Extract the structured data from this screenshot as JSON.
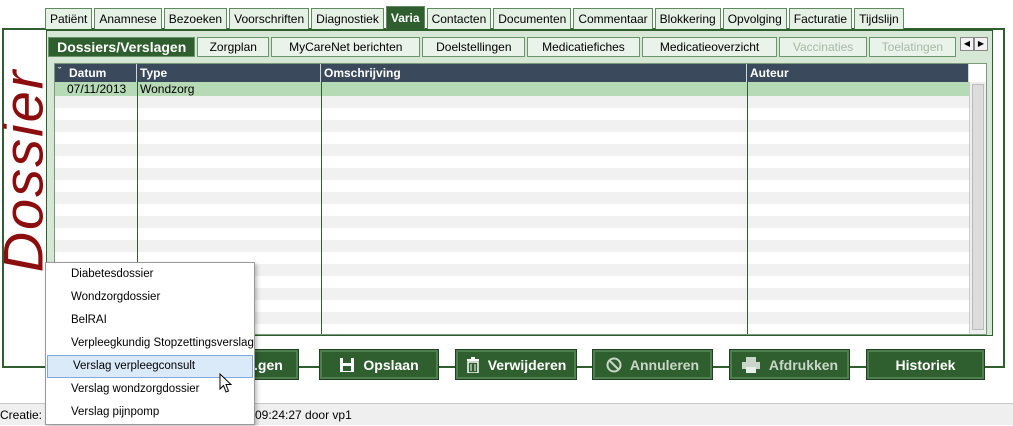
{
  "side_title": "Dossier",
  "main_tabs": [
    {
      "label": "Patiënt",
      "active": false
    },
    {
      "label": "Anamnese",
      "active": false
    },
    {
      "label": "Bezoeken",
      "active": false
    },
    {
      "label": "Voorschriften",
      "active": false
    },
    {
      "label": "Diagnostiek",
      "active": false
    },
    {
      "label": "Varia",
      "active": true
    },
    {
      "label": "Contacten",
      "active": false
    },
    {
      "label": "Documenten",
      "active": false
    },
    {
      "label": "Commentaar",
      "active": false
    },
    {
      "label": "Blokkering",
      "active": false
    },
    {
      "label": "Opvolging",
      "active": false
    },
    {
      "label": "Facturatie",
      "active": false
    },
    {
      "label": "Tijdslijn",
      "active": false
    }
  ],
  "sub_tabs": [
    {
      "label": "Dossiers/Verslagen",
      "state": "active"
    },
    {
      "label": "Zorgplan",
      "state": "normal"
    },
    {
      "label": "MyCareNet berichten",
      "state": "normal"
    },
    {
      "label": "Doelstellingen",
      "state": "normal"
    },
    {
      "label": "Medicatiefiches",
      "state": "normal"
    },
    {
      "label": "Medicatieoverzicht",
      "state": "normal"
    },
    {
      "label": "Vaccinaties",
      "state": "disabled"
    },
    {
      "label": "Toelatingen",
      "state": "disabled"
    }
  ],
  "table": {
    "columns": [
      "Datum",
      "Type",
      "Omschrijving",
      "Auteur"
    ],
    "rows": [
      {
        "datum": "07/11/2013",
        "type": "Wondzorg",
        "omschrijving": "",
        "auteur": ""
      }
    ]
  },
  "buttons": [
    {
      "label": "...gen",
      "icon": "none-icon",
      "state": "enabled"
    },
    {
      "label": "Opslaan",
      "icon": "floppy-icon",
      "state": "enabled"
    },
    {
      "label": "Verwijderen",
      "icon": "trash-icon",
      "state": "enabled"
    },
    {
      "label": "Annuleren",
      "icon": "cancel-icon",
      "state": "disabled"
    },
    {
      "label": "Afdrukken",
      "icon": "printer-icon",
      "state": "disabled"
    },
    {
      "label": "Historiek",
      "icon": "none-icon",
      "state": "enabled"
    }
  ],
  "status": {
    "left": "Creatie: 23",
    "right": "09:24:27 door vp1"
  },
  "popup_menu": {
    "items": [
      {
        "label": "Diabetesdossier"
      },
      {
        "label": "Wondzorgdossier"
      },
      {
        "label": "BelRAI"
      },
      {
        "label": "Verpleegkundig Stopzettingsverslag"
      },
      {
        "label": "Verslag verpleegconsult",
        "highlighted": true
      },
      {
        "label": "Verslag wondzorgdossier"
      },
      {
        "label": "Verslag pijnpomp"
      }
    ]
  },
  "colors": {
    "accent_green": "#2f5f2f",
    "title_red": "#8b0d0d",
    "header_navy": "#3a4a5c",
    "selected_row": "#b6d9b6",
    "highlight_blue": "#dbeaf9"
  }
}
